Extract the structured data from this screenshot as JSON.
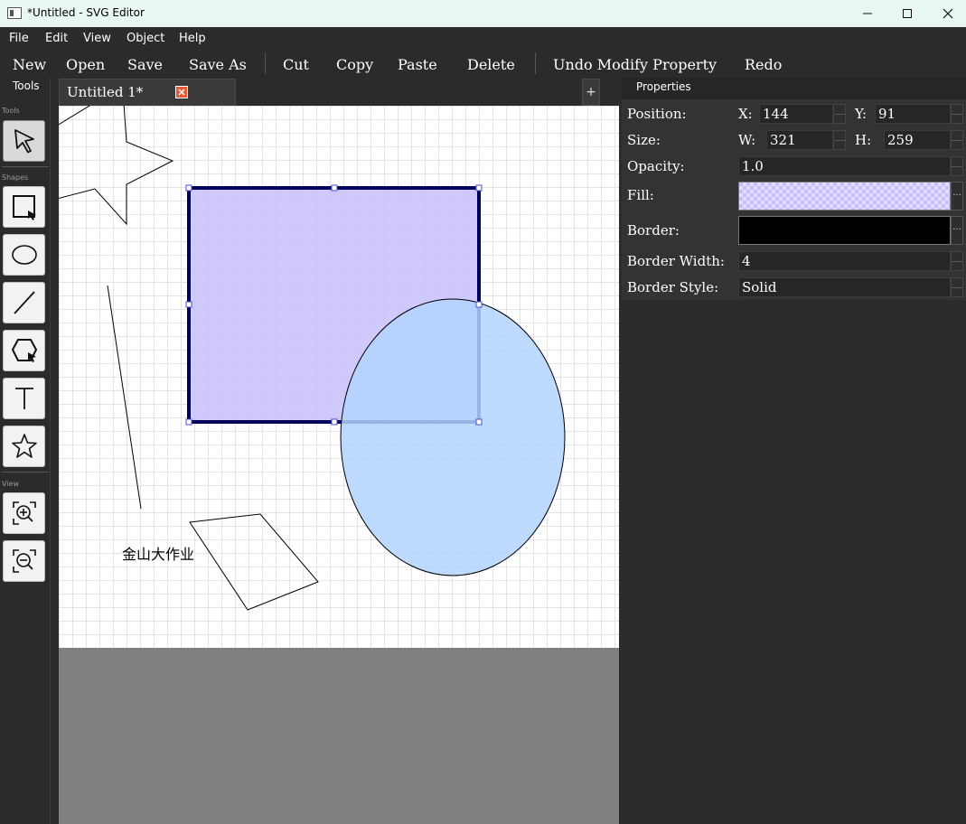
{
  "window": {
    "title": "*Untitled - SVG Editor"
  },
  "menu": [
    "File",
    "Edit",
    "View",
    "Object",
    "Help"
  ],
  "toolbar": {
    "new": "New",
    "open": "Open",
    "save": "Save",
    "save_as": "Save As",
    "cut": "Cut",
    "copy": "Copy",
    "paste": "Paste",
    "delete": "Delete",
    "undo": "Undo Modify Property",
    "redo": "Redo"
  },
  "tools_panel": {
    "title": "Tools",
    "group_tools": "Tools",
    "group_shapes": "Shapes",
    "group_view": "View",
    "items": [
      "select-tool",
      "rectangle-tool",
      "ellipse-tool",
      "line-tool",
      "polygon-tool",
      "text-tool",
      "star-tool",
      "zoom-in-tool",
      "zoom-out-tool"
    ]
  },
  "document": {
    "tab_label": "Untitled 1*",
    "new_tab": "+",
    "canvas_text": "金山大作业"
  },
  "properties": {
    "title": "Properties",
    "position_label": "Position:",
    "x_label": "X:",
    "x_value": "144",
    "y_label": "Y:",
    "y_value": "91",
    "size_label": "Size:",
    "w_label": "W:",
    "w_value": "321",
    "h_label": "H:",
    "h_value": "259",
    "opacity_label": "Opacity:",
    "opacity_value": "1.0",
    "fill_label": "Fill:",
    "fill_color": "#c8c1fc",
    "border_label": "Border:",
    "border_color": "#000000",
    "border_width_label": "Border Width:",
    "border_width_value": "4",
    "border_style_label": "Border Style:",
    "border_style_value": "Solid",
    "more_glyph": "..."
  },
  "colors": {
    "rect_fill": "#c8c1fc",
    "ellipse_fill": "#b3d4fe",
    "selection_stroke": "#00005a",
    "handle": "#4b4bd8",
    "close_accent": "#e55b37"
  }
}
